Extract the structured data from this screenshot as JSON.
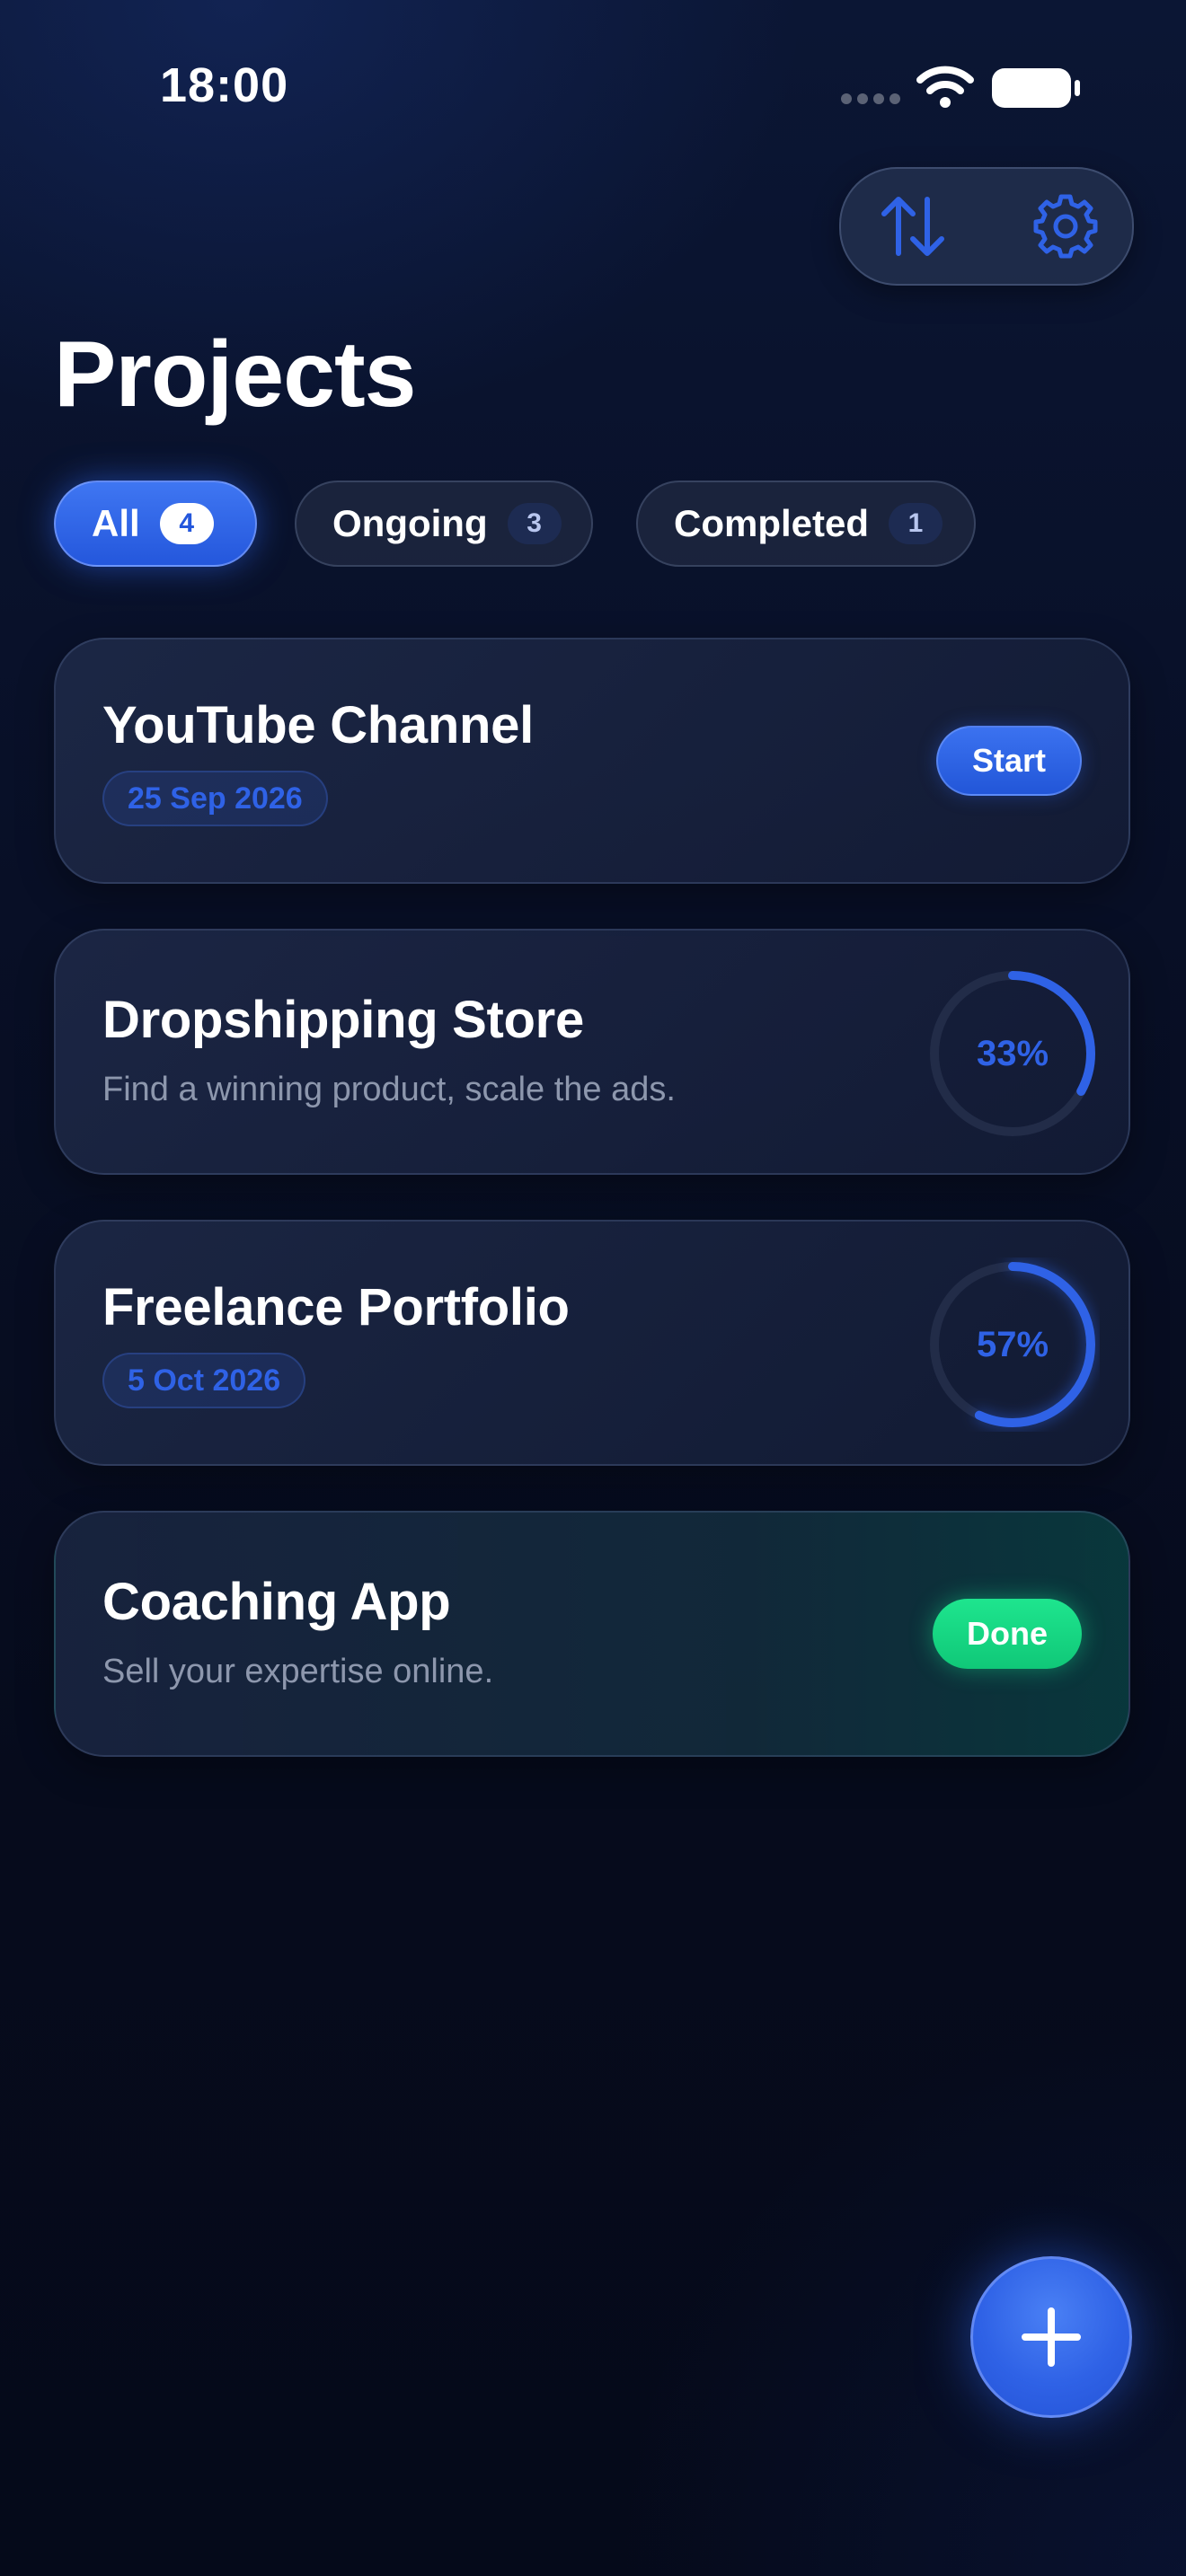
{
  "status_bar": {
    "time": "18:00"
  },
  "toolbar": {
    "sort_icon": "sort-arrows-icon",
    "settings_icon": "gear-icon"
  },
  "page_title": "Projects",
  "filters": [
    {
      "label": "All",
      "count": "4",
      "active": true
    },
    {
      "label": "Ongoing",
      "count": "3",
      "active": false
    },
    {
      "label": "Completed",
      "count": "1",
      "active": false
    }
  ],
  "projects": [
    {
      "title": "YouTube Channel",
      "date": "25 Sep 2026",
      "action": "Start"
    },
    {
      "title": "Dropshipping Store",
      "subtitle": "Find a winning product, scale the ads.",
      "progress": 0.33,
      "progress_label": "33%"
    },
    {
      "title": "Freelance Portfolio",
      "date": "5 Oct 2026",
      "progress": 0.57,
      "progress_label": "57%"
    },
    {
      "title": "Coaching App",
      "subtitle": "Sell your expertise online.",
      "status": "Done"
    }
  ],
  "fab": {
    "icon": "plus-icon"
  },
  "colors": {
    "accent": "#2f62e6",
    "success": "#16d483",
    "background": "#070d22",
    "muted_text": "#8d97ad"
  }
}
